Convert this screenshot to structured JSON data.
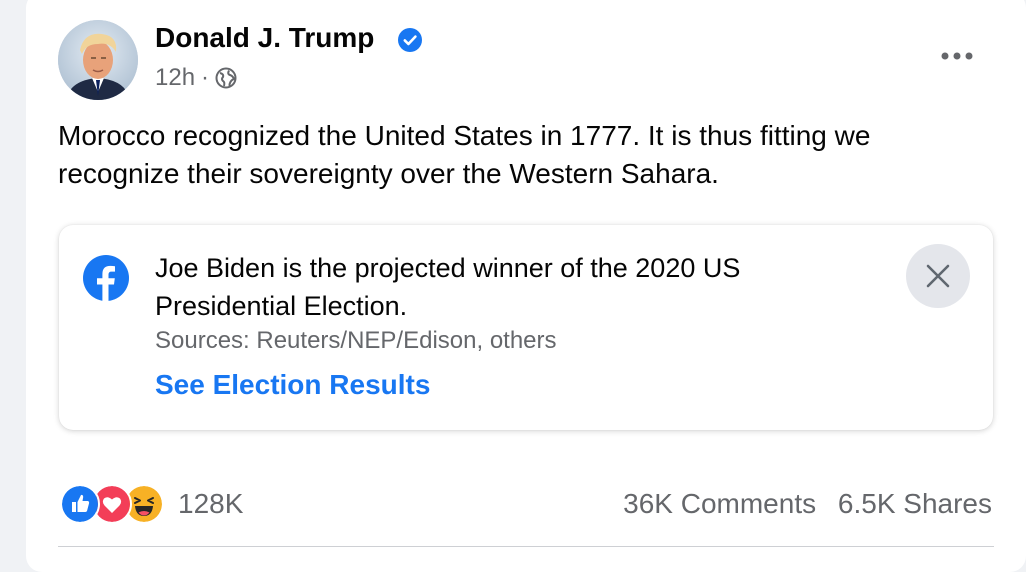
{
  "post": {
    "author": "Donald J. Trump",
    "time": "12h",
    "separator": "·",
    "audience_icon": "globe-icon",
    "verified_icon": "verified-badge-icon",
    "more_icon": "more-options-icon",
    "text": "Morocco recognized the United States in 1777.  It is thus fitting we recognize their sovereignty over the Western Sahara."
  },
  "notice": {
    "icon": "facebook-logo-icon",
    "title": "Joe Biden is the projected winner of the 2020 US Presidential Election.",
    "sources": "Sources: Reuters/NEP/Edison, others",
    "link": "See Election Results",
    "close_icon": "close-icon"
  },
  "engagement": {
    "reaction_icons": [
      "like-reaction-icon",
      "love-reaction-icon",
      "haha-reaction-icon"
    ],
    "reaction_count": "128K",
    "comments": "36K Comments",
    "shares": "6.5K Shares"
  },
  "colors": {
    "accent": "#1877f2",
    "secondary_text": "#65676b",
    "like": "#1877f2",
    "love": "#f33e58",
    "haha": "#f7b125"
  }
}
